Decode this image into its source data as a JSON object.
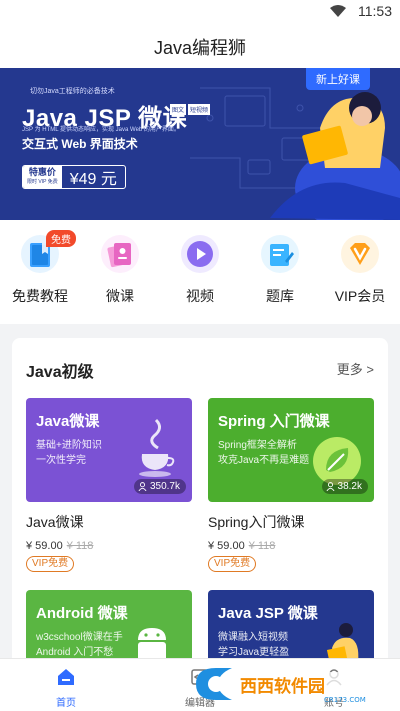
{
  "status": {
    "time": "11:53"
  },
  "app": {
    "title": "Java编程狮"
  },
  "banner": {
    "small_text": "切勿Java工程师的必备技术",
    "main_title": "Java JSP 微课",
    "tags": [
      "图文",
      "短视频"
    ],
    "desc": "JSP 为 HTML 提供动态响应，实现 Java Web 的用户界面。",
    "headline": "交互式 Web 界面技术",
    "price_label": "特惠价",
    "price_sub": "限时 VIP 免费",
    "price": "¥49 元",
    "new_badge": "新上好课"
  },
  "quicknav": {
    "items": [
      {
        "label": "免费教程",
        "icon": "book-icon",
        "badge": "免费"
      },
      {
        "label": "微课",
        "icon": "cards-icon"
      },
      {
        "label": "视频",
        "icon": "play-icon"
      },
      {
        "label": "题库",
        "icon": "edit-doc-icon"
      },
      {
        "label": "VIP会员",
        "icon": "vip-diamond-icon"
      }
    ]
  },
  "section": {
    "title": "Java初级",
    "more": "更多 >",
    "courses": [
      {
        "thumb_title": "Java微课",
        "thumb_sub1": "基础+进阶知识",
        "thumb_sub2": "一次性学完",
        "views": "350.7k",
        "title": "Java微课",
        "price": "¥ 59.00",
        "old_price": "¥ 118",
        "vip": "VIP免费",
        "color": "#7b52d4"
      },
      {
        "thumb_title": "Spring 入门微课",
        "thumb_sub1": "Spring框架全解析",
        "thumb_sub2": "攻克Java不再是难题",
        "views": "38.2k",
        "title": "Spring入门微课",
        "price": "¥ 59.00",
        "old_price": "¥ 118",
        "vip": "VIP免费",
        "color": "#4cae2e"
      },
      {
        "thumb_title": "Android 微课",
        "thumb_sub1": "w3cschool微课在手",
        "thumb_sub2": "Android  入门不愁",
        "color": "#5ab642"
      },
      {
        "thumb_title": "Java JSP 微课",
        "thumb_sub1": "微课融入短视频",
        "thumb_sub2": "学习Java更轻盈",
        "color": "#24388f"
      }
    ]
  },
  "tabbar": {
    "items": [
      {
        "label": "首页",
        "icon": "home-icon"
      },
      {
        "label": "编辑器",
        "icon": "code-icon"
      },
      {
        "label": "账号",
        "icon": "user-icon"
      }
    ]
  },
  "watermark": {
    "text": "西西软件园",
    "url": "CR173.COM"
  },
  "colors": {
    "accent": "#2f6bff",
    "vip": "#e07a24",
    "badge": "#f24a2b"
  }
}
